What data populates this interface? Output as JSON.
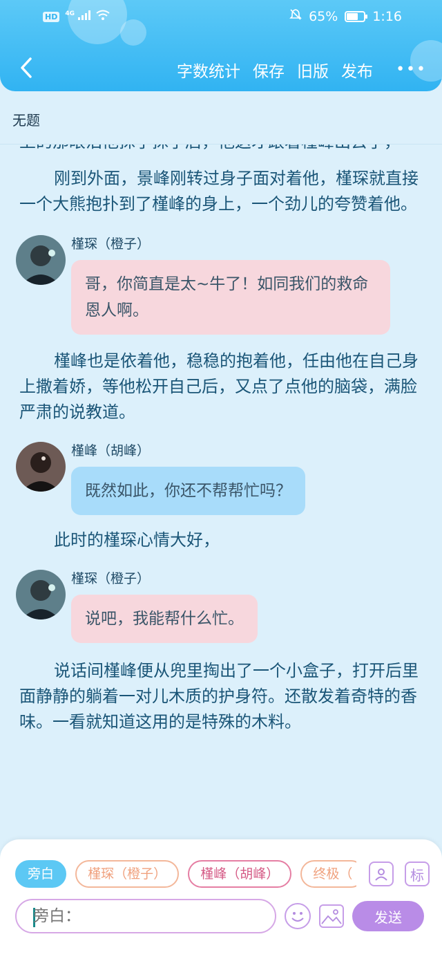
{
  "status_bar": {
    "network": "HD",
    "signal": "4G",
    "battery": "65%",
    "battery_level": 0.65,
    "time": "1:16"
  },
  "nav": {
    "actions": [
      "字数统计",
      "保存",
      "旧版",
      "发布"
    ],
    "more": "•••"
  },
  "document": {
    "title": "无题",
    "blocks": [
      {
        "type": "narration",
        "text": "上的那眼泪他抹了抹了后，他这才跟着槿峰出去了，",
        "indent": false
      },
      {
        "type": "narration",
        "text": "刚到外面，景峰刚转过身子面对着他，槿琛就直接一个大熊抱扑到了槿峰的身上，一个劲儿的夸赞着他。",
        "indent": true
      },
      {
        "type": "dialogue",
        "speaker": "槿琛（橙子）",
        "text": "哥，你简直是太~牛了！如同我们的救命恩人啊。",
        "color": "pink"
      },
      {
        "type": "narration",
        "text": "槿峰也是依着他，稳稳的抱着他，任由他在自己身上撒着娇，等他松开自己后，又点了点他的脑袋，满脸严肃的说教道。",
        "indent": true
      },
      {
        "type": "dialogue",
        "speaker": "槿峰（胡峰）",
        "text": "既然如此，你还不帮帮忙吗？",
        "color": "blue"
      },
      {
        "type": "narration",
        "text": "此时的槿琛心情大好，",
        "indent": true
      },
      {
        "type": "dialogue",
        "speaker": "槿琛（橙子）",
        "text": "说吧，我能帮什么忙。",
        "color": "pink"
      },
      {
        "type": "narration",
        "text": "说话间槿峰便从兜里掏出了一个小盒子，打开后里面静静的躺着一对儿木质的护身符。还散发着奇特的香味。一看就知道这用的是特殊的木料。",
        "indent": true
      }
    ]
  },
  "composer": {
    "roles": [
      "旁白",
      "槿琛（橙子）",
      "槿峰（胡峰）",
      "终极（"
    ],
    "active_role": "旁白",
    "input_placeholder": "旁白：",
    "mark_button": "标",
    "send_label": "发送"
  },
  "colors": {
    "header": "#31b3f2",
    "background": "#dcf0fb",
    "bubble_pink": "#f7d7dd",
    "bubble_blue": "#a8dcfa",
    "send": "#b98ce7"
  }
}
